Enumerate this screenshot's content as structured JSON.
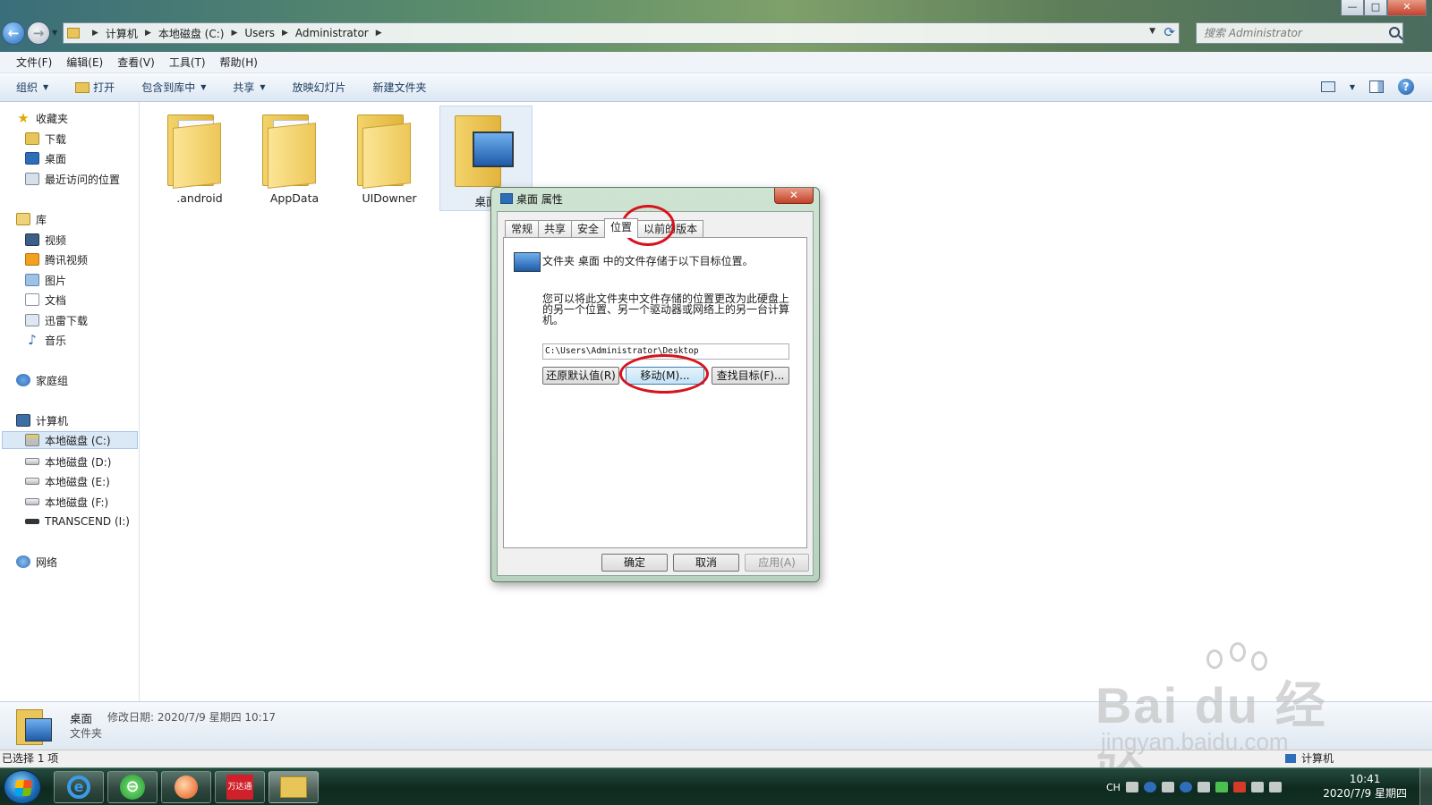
{
  "window": {
    "min_label": "—",
    "max_label": "□",
    "close_label": "✕"
  },
  "nav": {
    "back_label": "←",
    "forward_label": "→"
  },
  "address": {
    "segments": [
      "计算机",
      "本地磁盘 (C:)",
      "Users",
      "Administrator"
    ]
  },
  "search": {
    "placeholder": "搜索 Administrator"
  },
  "menu": {
    "items": [
      "文件(F)",
      "编辑(E)",
      "查看(V)",
      "工具(T)",
      "帮助(H)"
    ]
  },
  "toolbar": {
    "organize": "组织",
    "open": "打开",
    "include_library": "包含到库中",
    "share": "共享",
    "slideshow": "放映幻灯片",
    "new_folder": "新建文件夹",
    "help": "?"
  },
  "sidebar": {
    "favorites": "收藏夹",
    "downloads": "下载",
    "desktop": "桌面",
    "recent": "最近访问的位置",
    "libraries": "库",
    "videos": "视频",
    "tencent_video": "腾讯视频",
    "pictures": "图片",
    "documents": "文档",
    "thunder": "迅雷下载",
    "music": "音乐",
    "homegroup": "家庭组",
    "computer": "计算机",
    "drive_c": "本地磁盘 (C:)",
    "drive_d": "本地磁盘 (D:)",
    "drive_e": "本地磁盘 (E:)",
    "drive_f": "本地磁盘 (F:)",
    "drive_i": "TRANSCEND (I:)",
    "network": "网络"
  },
  "files": [
    {
      "name": ".android"
    },
    {
      "name": "AppData"
    },
    {
      "name": "UIDowner"
    },
    {
      "name": "桌面"
    }
  ],
  "details": {
    "name": "桌面",
    "modified": "修改日期: 2020/7/9 星期四 10:17",
    "type": "文件夹"
  },
  "status": {
    "selected": "已选择 1 项",
    "location": "计算机"
  },
  "dialog": {
    "title": "桌面 属性",
    "close": "✕",
    "tabs": [
      "常规",
      "共享",
      "安全",
      "位置",
      "以前的版本"
    ],
    "active_tab": "位置",
    "info": "文件夹 桌面 中的文件存储于以下目标位置。",
    "description": "您可以将此文件夹中文件存储的位置更改为此硬盘上的另一个位置、另一个驱动器或网络上的另一台计算机。",
    "path": "C:\\Users\\Administrator\\Desktop",
    "restore_btn": "还原默认值(R)",
    "move_btn": "移动(M)...",
    "find_btn": "查找目标(F)...",
    "ok_btn": "确定",
    "cancel_btn": "取消",
    "apply_btn": "应用(A)"
  },
  "watermark": {
    "logo": "Bai du 经验",
    "url": "jingyan.baidu.com"
  },
  "taskbar": {
    "red_app_label": "万达通",
    "tray_lang": "CH",
    "time": "10:41",
    "date": "2020/7/9 星期四"
  },
  "colors": {
    "highlight_circle": "#d6141c",
    "selection": "#dbe8f6",
    "dialog_frame": "#b9d2bf"
  }
}
